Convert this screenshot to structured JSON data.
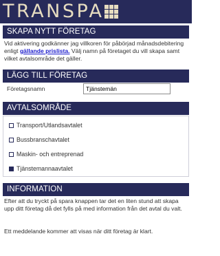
{
  "header": {
    "logo_text": "TRANSPA",
    "logo_icon": "grid-icon",
    "brand_color": "#272a5a",
    "logo_color": "#e6dcc0"
  },
  "section_create": {
    "title": "SKAPA NYTT FÖRETAG",
    "text_before_link": "Vid aktivering godkänner jag villkoren för påbörjad månadsdebitering enligt ",
    "link_text": "gällande prislista.",
    "text_after_link": " Välj namn på företaget du vill skapa samt vilket avtalsområde det gäller."
  },
  "section_add": {
    "title": "LÄGG TILL FÖRETAG",
    "field_label": "Företagsnamn",
    "field_value": "Tjänstemän"
  },
  "section_agreement": {
    "title": "AVTALSOMRÅDE",
    "options": [
      {
        "label": "Transport/Utlandsavtalet",
        "checked": false
      },
      {
        "label": "Bussbranschavtalet",
        "checked": false
      },
      {
        "label": "Maskin- och entreprenad",
        "checked": false
      },
      {
        "label": "Tjänstemannaavtalet",
        "checked": true
      }
    ]
  },
  "section_info": {
    "title": "INFORMATION",
    "paragraph1": "Efter att du tryckt på spara knappen tar det en liten stund att skapa upp ditt företag då det fylls på med information från det avtal du valt.",
    "paragraph2": "Ett meddelande kommer att visas när ditt företag är klart."
  }
}
